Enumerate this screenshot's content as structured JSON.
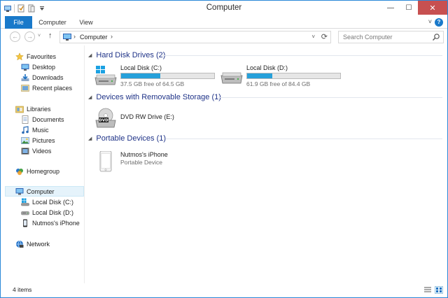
{
  "window": {
    "title": "Computer",
    "minimize_glyph": "—",
    "maximize_glyph": "☐",
    "close_glyph": "✕"
  },
  "ribbon": {
    "tabs": [
      "File",
      "Computer",
      "View"
    ],
    "expand_glyph": "˅",
    "help_glyph": "?"
  },
  "nav": {
    "back_glyph": "←",
    "forward_glyph": "→",
    "recent_glyph": "˅",
    "up_glyph": "↑",
    "address_text": "Computer",
    "crumb_sep": "›",
    "address_dd_glyph": "˅",
    "refresh_glyph": "⟳",
    "search_placeholder": "Search Computer"
  },
  "sidebar": {
    "items": [
      {
        "label": "Favourites",
        "icon": "star-icon"
      },
      {
        "label": "Desktop",
        "icon": "desktop-icon"
      },
      {
        "label": "Downloads",
        "icon": "downloads-icon"
      },
      {
        "label": "Recent places",
        "icon": "recent-places-icon"
      },
      {
        "label": "Libraries",
        "icon": "libraries-icon"
      },
      {
        "label": "Documents",
        "icon": "documents-icon"
      },
      {
        "label": "Music",
        "icon": "music-icon"
      },
      {
        "label": "Pictures",
        "icon": "pictures-icon"
      },
      {
        "label": "Videos",
        "icon": "videos-icon"
      },
      {
        "label": "Homegroup",
        "icon": "homegroup-icon"
      },
      {
        "label": "Computer",
        "icon": "computer-icon"
      },
      {
        "label": "Local Disk (C:)",
        "icon": "system-drive-icon"
      },
      {
        "label": "Local Disk (D:)",
        "icon": "drive-icon"
      },
      {
        "label": "Nutmos's iPhone",
        "icon": "phone-icon"
      },
      {
        "label": "Network",
        "icon": "network-icon"
      }
    ]
  },
  "content": {
    "groups": [
      {
        "title": "Hard Disk Drives (2)"
      },
      {
        "title": "Devices with Removable Storage (1)"
      },
      {
        "title": "Portable Devices (1)"
      }
    ],
    "drives": [
      {
        "name": "Local Disk (C:)",
        "free_text": "37.5 GB free of 64.5 GB",
        "used_fraction": 0.42
      },
      {
        "name": "Local Disk (D:)",
        "free_text": "61.9 GB free of 84.4 GB",
        "used_fraction": 0.27
      }
    ],
    "removable": [
      {
        "name": "DVD RW Drive (E:)",
        "icon_label": "DVD"
      }
    ],
    "portable": [
      {
        "name": "Nutmos's iPhone",
        "subtitle": "Portable Device"
      }
    ],
    "collapse_glyph": "◢"
  },
  "status": {
    "item_count": "4 items"
  },
  "colors": {
    "accent": "#1979ca",
    "bar_fill": "#26a0da",
    "group_header": "#1e3287",
    "close": "#c75050"
  }
}
